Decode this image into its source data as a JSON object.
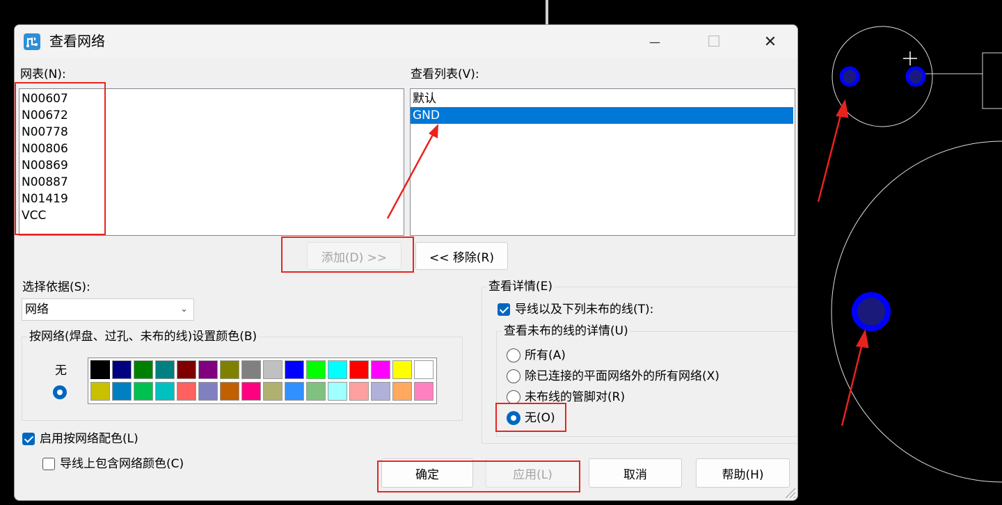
{
  "dialog": {
    "title": "查看网络",
    "icon": "app-icon",
    "window_buttons": {
      "minimize": "—",
      "maximize": "☐",
      "close": "✕"
    }
  },
  "netlist": {
    "label": "网表(N):",
    "items": [
      "N00607",
      "N00672",
      "N00778",
      "N00806",
      "N00869",
      "N00887",
      "N01419",
      "VCC"
    ]
  },
  "viewlist": {
    "label": "查看列表(V):",
    "items": [
      "默认",
      "GND"
    ],
    "selected": "GND"
  },
  "buttons": {
    "add": "添加(D) >>",
    "remove": "<<  移除(R)",
    "ok": "确定",
    "apply": "应用(L)",
    "cancel": "取消",
    "help": "帮助(H)"
  },
  "select_by": {
    "label": "选择依据(S):",
    "value": "网络"
  },
  "color_group": {
    "label": "按网络(焊盘、过孔、未布的线)设置颜色(B)",
    "none_label": "无",
    "row1": [
      "#000000",
      "#000080",
      "#008000",
      "#008080",
      "#800000",
      "#800080",
      "#808000",
      "#808080",
      "#c0c0c0",
      "#0000ff",
      "#00ff00",
      "#00ffff",
      "#ff0000",
      "#ff00ff",
      "#ffff00",
      "#ffffff"
    ],
    "row2": [
      "#c8c000",
      "#0080c0",
      "#00c050",
      "#00c0c0",
      "#ff6060",
      "#8080c0",
      "#c06000",
      "#ff0080",
      "#b0b070",
      "#3090ff",
      "#80c080",
      "#a0ffff",
      "#ffa0a0",
      "#b0b0d8",
      "#ffa860",
      "#ff80c0"
    ]
  },
  "checkboxes": {
    "enable_color": {
      "label": "启用按网络配色(L)",
      "checked": true
    },
    "include_traces": {
      "label": "导线上包含网络颜色(C)",
      "checked": false
    }
  },
  "details": {
    "label": "查看详情(E)",
    "traces_checkbox": {
      "label": "导线以及下列未布的线(T):",
      "checked": true
    },
    "unrouted_label": "查看未布的线的详情(U)",
    "radios": [
      {
        "label": "所有(A)",
        "checked": false
      },
      {
        "label": "除已连接的平面网络外的所有网络(X)",
        "checked": false
      },
      {
        "label": "未布线的管脚对(R)",
        "checked": false
      },
      {
        "label": "无(O)",
        "checked": true
      }
    ]
  },
  "colors": {
    "accent": "#0067c0",
    "selection": "#0078d7",
    "annotation": "#e8231f",
    "pad": "#0000ff"
  }
}
